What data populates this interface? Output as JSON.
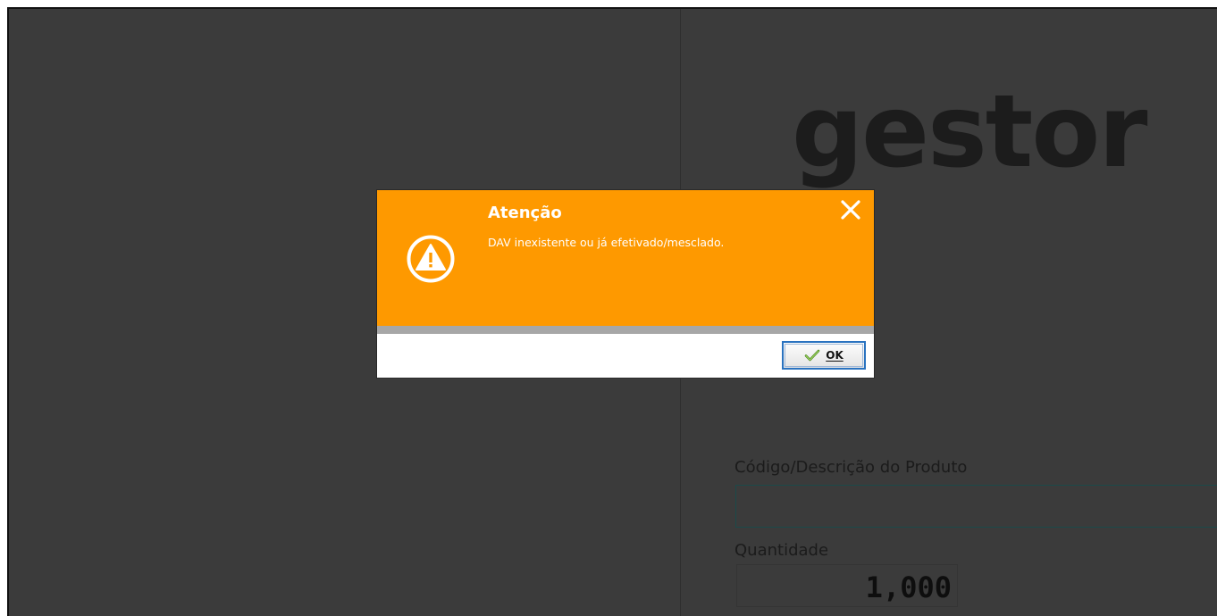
{
  "background": {
    "brand_text": "gestor",
    "product_field": {
      "label": "Código/Descrição do Produto",
      "value": "",
      "placeholder": ""
    },
    "quantity_field": {
      "label": "Quantidade",
      "value": "1,000"
    }
  },
  "dialog": {
    "title": "Atenção",
    "message": "DAV inexistente ou já efetivado/mesclado.",
    "icon": "warning-icon",
    "close_icon": "close-icon",
    "ok_label": "OK",
    "ok_icon": "check-icon",
    "header_color": "#FE9900"
  }
}
